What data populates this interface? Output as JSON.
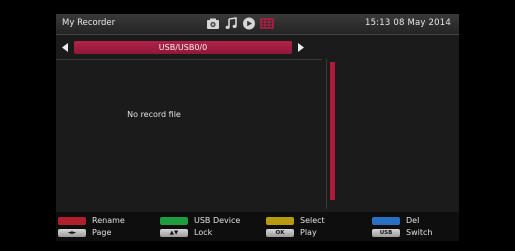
{
  "header": {
    "title": "My Recorder",
    "clock": "15:13 08 May 2014",
    "media_icons": [
      "photo-icon",
      "music-icon",
      "video-icon",
      "record-icon"
    ]
  },
  "path_selector": {
    "path": "USB/USB0/0"
  },
  "file_list": {
    "empty_message": "No record file"
  },
  "footer": {
    "color_hints": [
      {
        "label": "Rename",
        "color": "#b21f2c"
      },
      {
        "label": "USB Device",
        "color": "#1f9c3d"
      },
      {
        "label": "Select",
        "color": "#b79a12"
      },
      {
        "label": "Del",
        "color": "#2b6fc4"
      }
    ],
    "key_hints": [
      {
        "key": "◄►",
        "label": "Page"
      },
      {
        "key": "▲▼",
        "label": "Lock"
      },
      {
        "key": "OK",
        "label": "Play"
      },
      {
        "key": "USB",
        "label": "Switch"
      }
    ]
  }
}
